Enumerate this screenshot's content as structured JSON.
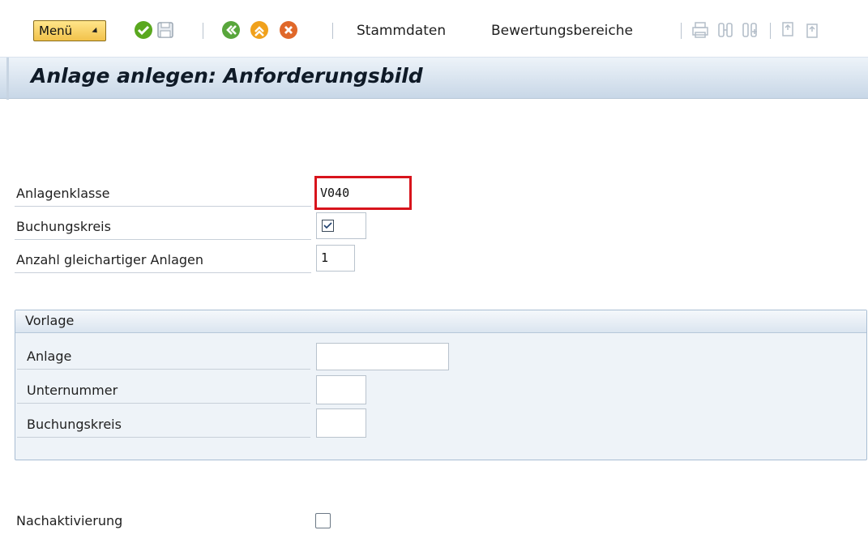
{
  "toolbar": {
    "menu_label": "Menü",
    "links": [
      "Stammdaten",
      "Bewertungsbereiche"
    ]
  },
  "title": "Anlage anlegen:  Anforderungsbild",
  "form": {
    "anlagenklasse": {
      "label": "Anlagenklasse",
      "value": "V040"
    },
    "buchungskreis": {
      "label": "Buchungskreis",
      "checked": true
    },
    "anzahl": {
      "label": "Anzahl gleichartiger Anlagen",
      "value": "1"
    }
  },
  "vorlage": {
    "title": "Vorlage",
    "anlage": {
      "label": "Anlage",
      "value": ""
    },
    "unternummer": {
      "label": "Unternummer",
      "value": ""
    },
    "buchungskreis": {
      "label": "Buchungskreis",
      "value": ""
    }
  },
  "nachaktivierung": {
    "label": "Nachaktivierung",
    "checked": false
  },
  "colors": {
    "highlight_border": "#d8141c",
    "menu_button": "#f2c24b",
    "title_bar": "#c8d7e7"
  }
}
